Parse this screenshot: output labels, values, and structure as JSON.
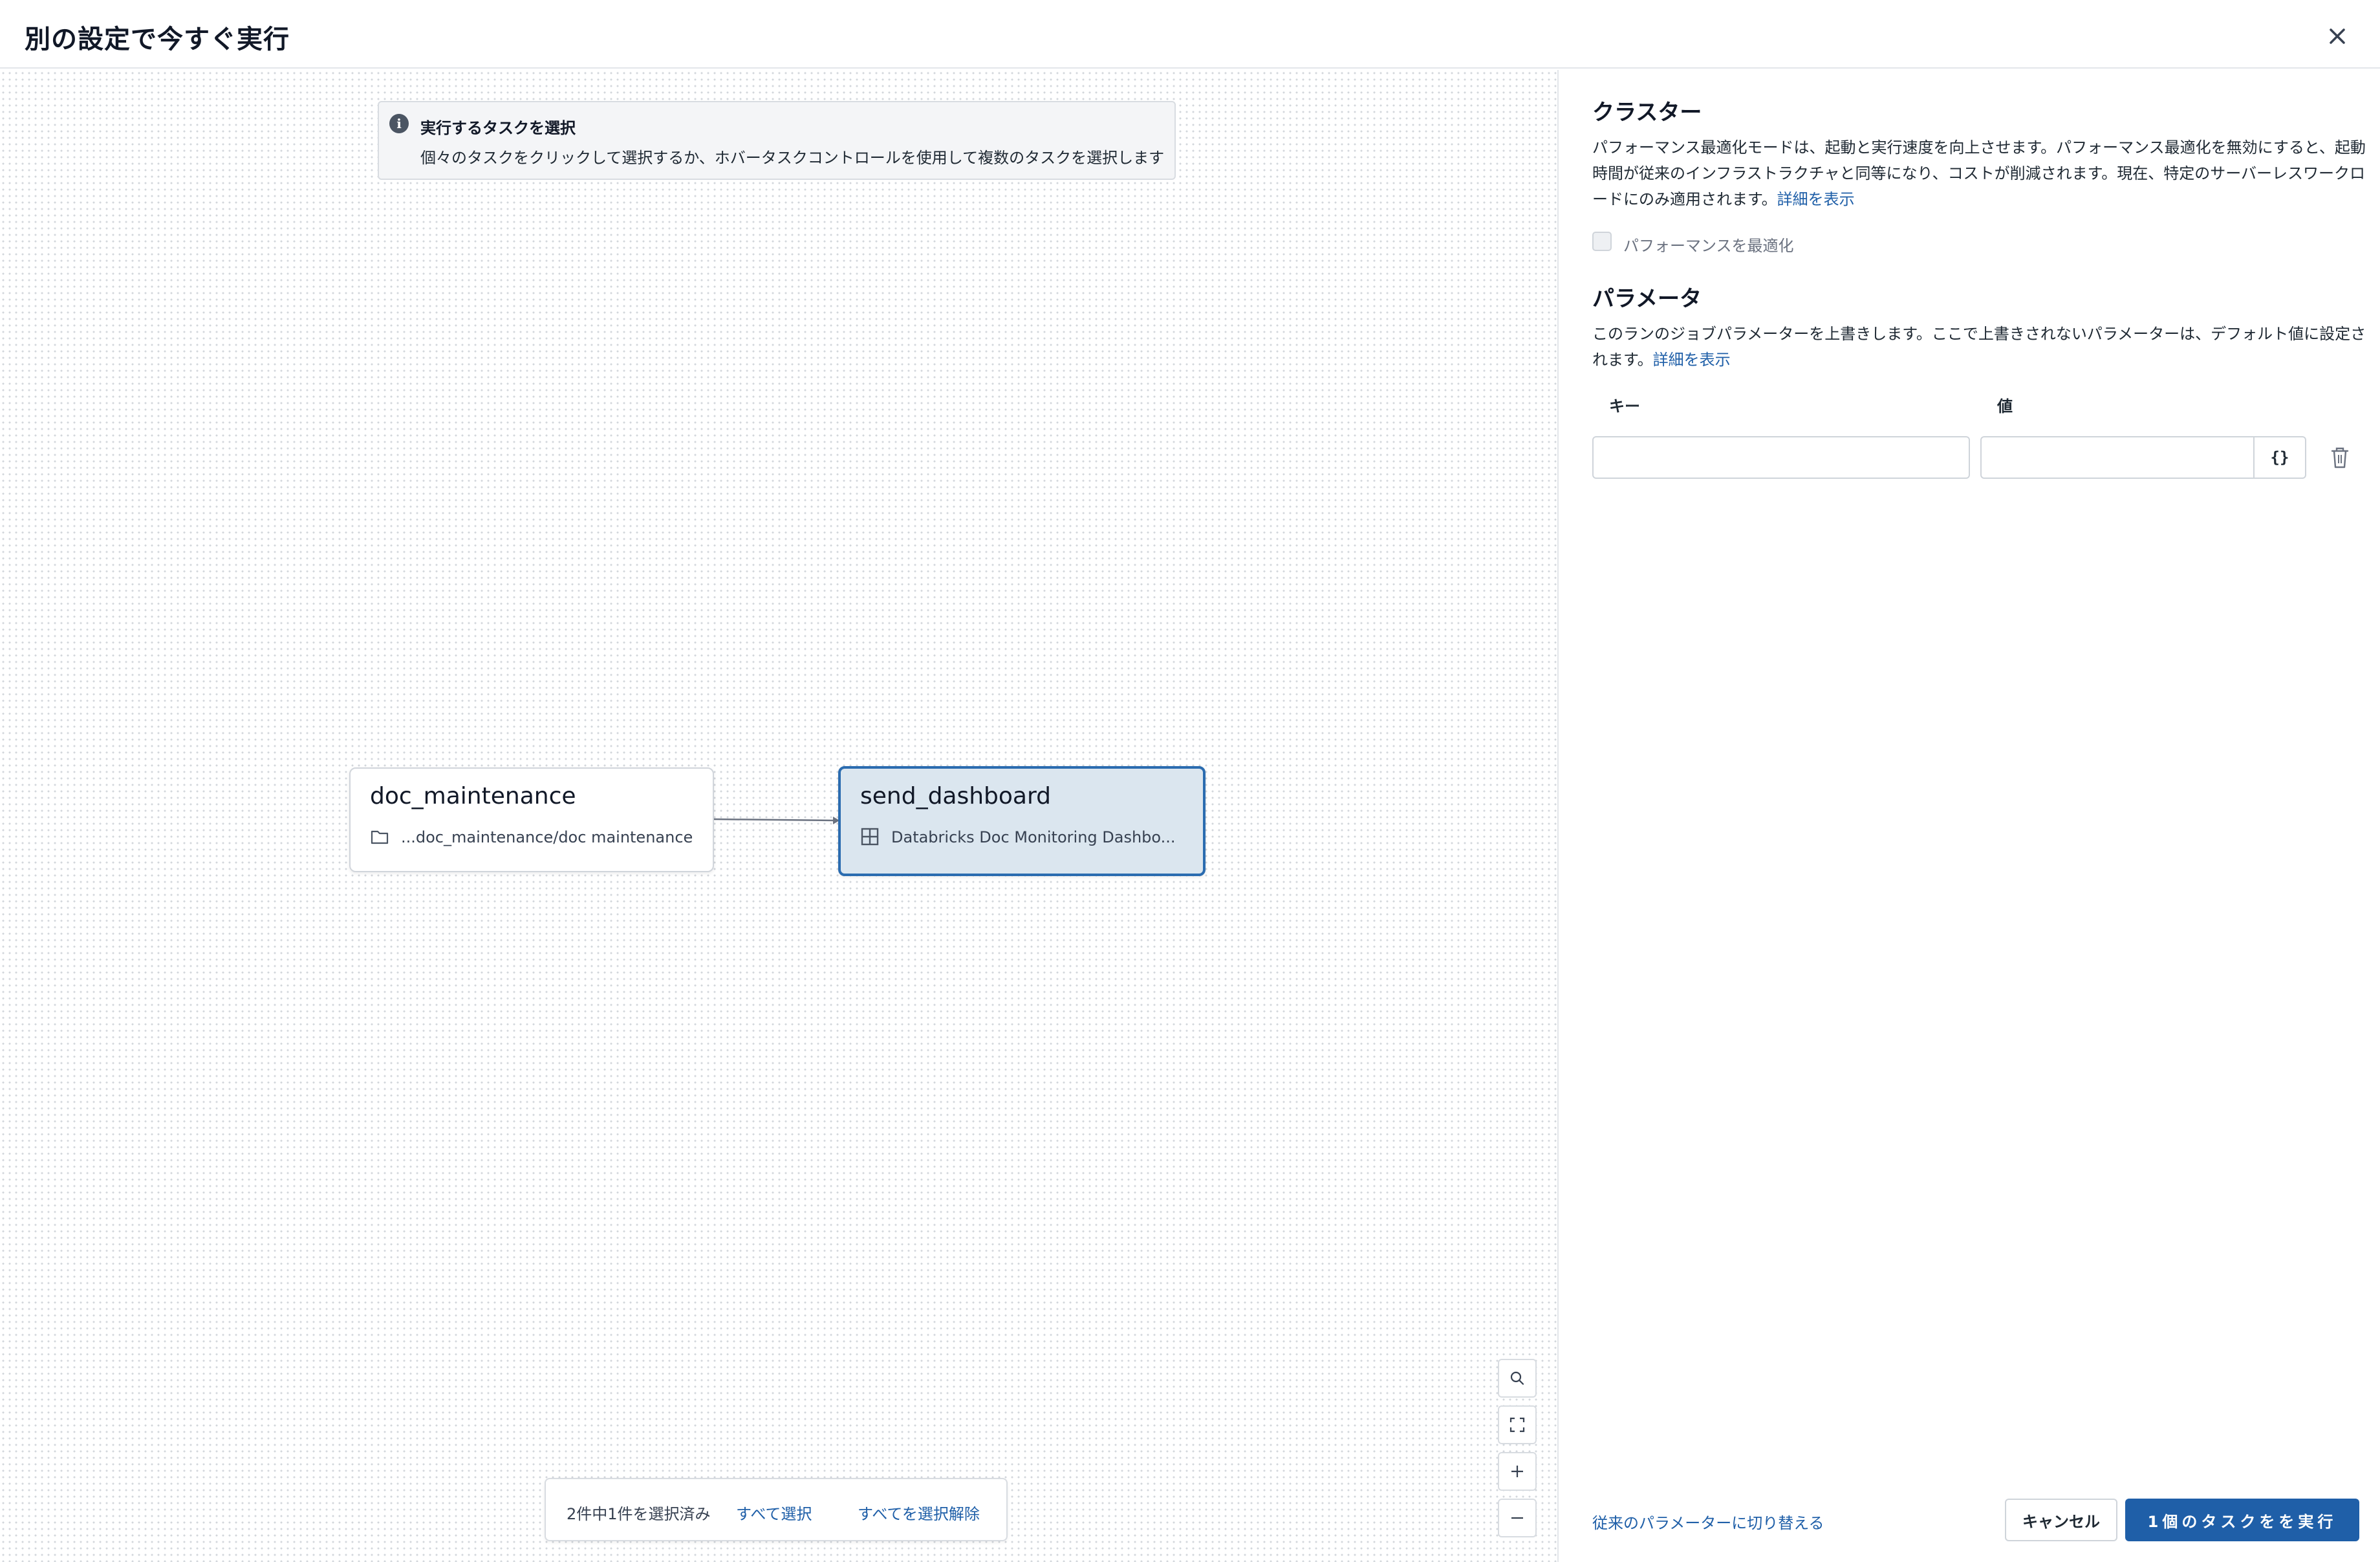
{
  "dialog": {
    "title": "別の設定で今すぐ実行"
  },
  "canvas": {
    "info_banner": {
      "title": "実行するタスクを選択",
      "text": "個々のタスクをクリックして選択するか、ホバータスクコントロールを使用して複数のタスクを選択します"
    },
    "nodes": [
      {
        "title": "doc_maintenance",
        "subtitle": "...doc_maintenance/doc maintenance",
        "icon": "folder-icon",
        "selected": false
      },
      {
        "title": "send_dashboard",
        "subtitle": "Databricks Doc Monitoring Dashbo...",
        "icon": "dashboard-icon",
        "selected": true
      }
    ],
    "selection_bar": {
      "count_text": "2件中1件を選択済み",
      "select_all": "すべて選択",
      "deselect_all": "すべてを選択解除"
    },
    "controls": [
      "search-icon",
      "fit-view-icon",
      "zoom-in-icon",
      "zoom-out-icon"
    ]
  },
  "panel": {
    "cluster": {
      "title": "クラスター",
      "description": "パフォーマンス最適化モードは、起動と実行速度を向上させます。パフォーマンス最適化を無効にすると、起動時間が従来のインフラストラクチャと同等になり、コストが削減されます。現在、特定のサーバーレスワークロードにのみ適用されます。",
      "learn_more": "詳細を表示",
      "checkbox_label": "パフォーマンスを最適化",
      "checkbox_checked": false
    },
    "parameters": {
      "title": "パラメータ",
      "description": "このランのジョブパラメーターを上書きします。ここで上書きされないパラメーターは、デフォルト値に設定されます。",
      "learn_more": "詳細を表示",
      "key_label": "キー",
      "value_label": "値",
      "key_value": "",
      "value_value": "",
      "json_button": "{}"
    },
    "footer": {
      "legacy_link": "従来のパラメーターに切り替える",
      "cancel": "キャンセル",
      "run": "1個のタスクをを実行"
    }
  },
  "colors": {
    "accent": "#1f5fa8",
    "selected_node_bg": "#dbe6ef",
    "selected_node_border": "#2b6cb0"
  }
}
